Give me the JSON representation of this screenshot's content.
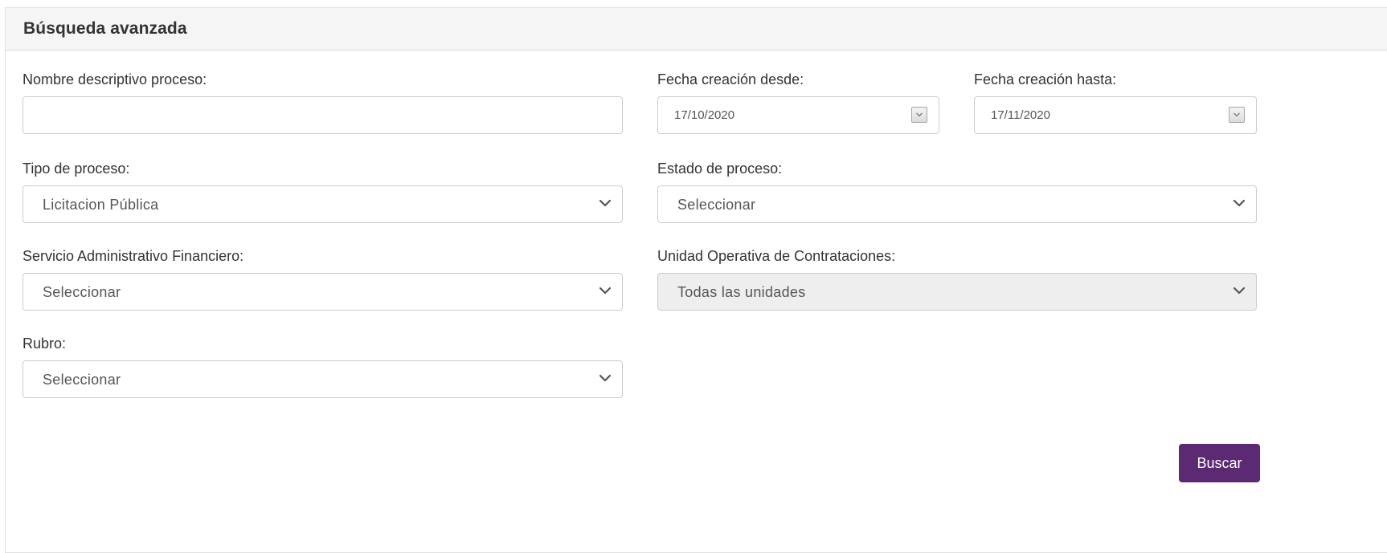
{
  "panel": {
    "title": "Búsqueda avanzada"
  },
  "fields": {
    "nombre": {
      "label": "Nombre descriptivo proceso:",
      "value": ""
    },
    "fecha_desde": {
      "label": "Fecha creación desde:",
      "value": "17/10/2020"
    },
    "fecha_hasta": {
      "label": "Fecha creación hasta:",
      "value": "17/11/2020"
    },
    "tipo_proceso": {
      "label": "Tipo de proceso:",
      "selected": "Licitacion Pública"
    },
    "estado_proceso": {
      "label": "Estado de proceso:",
      "selected": "Seleccionar"
    },
    "servicio_admin": {
      "label": "Servicio Administrativo Financiero:",
      "selected": "Seleccionar"
    },
    "unidad_operativa": {
      "label": "Unidad Operativa de Contrataciones:",
      "selected": "Todas las unidades",
      "disabled": true
    },
    "rubro": {
      "label": "Rubro:",
      "selected": "Seleccionar"
    }
  },
  "actions": {
    "search_label": "Buscar"
  },
  "colors": {
    "accent": "#5c2a73",
    "header_bg": "#f5f5f5",
    "border": "#cccccc",
    "disabled_bg": "#eeeeee",
    "label_text": "#333333",
    "field_text": "#555555"
  },
  "icons": {
    "select_arrow": "chevron-down-icon",
    "date_picker": "calendar-dropdown-icon"
  }
}
